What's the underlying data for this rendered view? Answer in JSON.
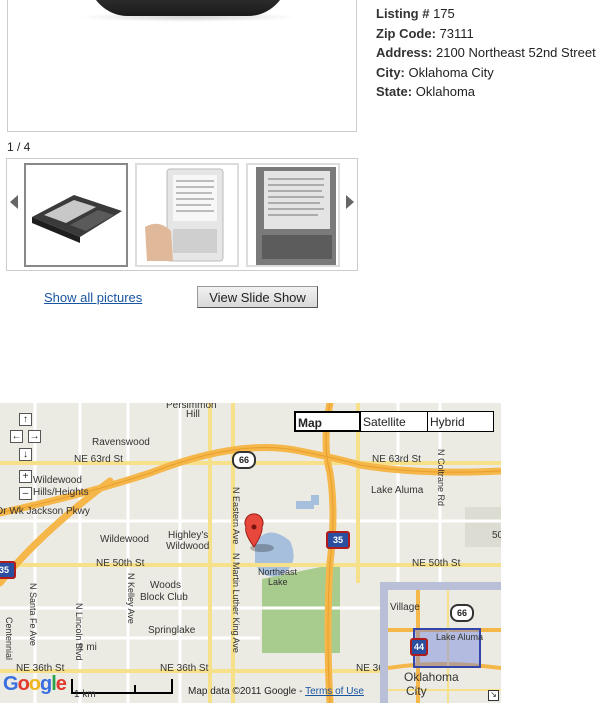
{
  "listing": {
    "rows": [
      {
        "label": "Listing #",
        "value": "175"
      },
      {
        "label": "Zip Code:",
        "value": "73111"
      },
      {
        "label": "Address:",
        "value": "2100 Northeast 52nd Street"
      },
      {
        "label": "City:",
        "value": "Oklahoma City"
      },
      {
        "label": "State:",
        "value": "Oklahoma"
      }
    ]
  },
  "gallery": {
    "counter": "1 / 4",
    "show_all": "Show all pictures",
    "slideshow": "View Slide Show"
  },
  "map": {
    "types": [
      "Map",
      "Satellite",
      "Hybrid"
    ],
    "nav": {
      "up": "↑",
      "left": "←",
      "right": "→",
      "down": "↓",
      "zoom_in": "+",
      "zoom_out": "–"
    },
    "labels": {
      "persimmon": "Persimmon",
      "hill": "Hill",
      "ravenswood": "Ravenswood",
      "ne63_w": "NE 63rd St",
      "ne63_e": "NE 63rd St",
      "wildewood_hills": "Wildewood",
      "hills_heights": "Hills/Heights",
      "jackson": "Dr Wk Jackson Pkwy",
      "lake_aluma": "Lake Aluma",
      "highleys": "Highley's",
      "highleys2": "Wildwood",
      "wildewood": "Wildewood",
      "ne50_w": "NE 50th St",
      "ne50_e": "NE 50th St",
      "northeast": "Northeast",
      "lake": "Lake",
      "woods": "Woods",
      "block": "Block Club",
      "springlake": "Springlake",
      "ne36_w": "NE 36th St",
      "ne36_e": "NE 36th St",
      "ne36_far": "NE 36",
      "one_mi": "1 mi",
      "village": "Village",
      "ov_lake": "Lake Aluma",
      "ov_city1": "Oklahoma",
      "ov_city2": "City",
      "fifty": "50",
      "n_santa": "N Santa Fe Ave",
      "n_lincoln": "N Lincoln Blvd",
      "n_kelley": "N Kelley Ave",
      "n_eastern": "N Eastern Ave",
      "n_mlk": "N Martin Luther King Ave",
      "n_coltrane": "N Coltrane Rd",
      "centennial": "Centennial"
    },
    "shields": {
      "us66": "66",
      "i35": "35",
      "i35b": "35",
      "us66b": "66",
      "i44": "44"
    },
    "google": "Google",
    "scale_km": "1 km",
    "copyright": "Map data ©2011 Google - ",
    "terms": "Terms of Use"
  },
  "colors": {
    "link": "#1a55a0",
    "highway": "#f5b64a",
    "water": "#a6bfdc",
    "park": "#a8cc8e",
    "marker": "#e8473b"
  }
}
